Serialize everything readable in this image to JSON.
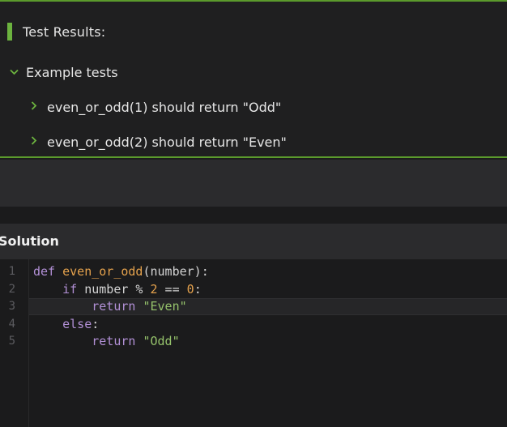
{
  "results": {
    "title": "Test Results:",
    "group": {
      "label": "Example tests",
      "expanded": true
    },
    "tests": [
      {
        "label": "even_or_odd(1) should return \"Odd\"",
        "expanded": false
      },
      {
        "label": "even_or_odd(2) should return \"Even\"",
        "expanded": false
      }
    ]
  },
  "solution": {
    "title": "Solution"
  },
  "editor": {
    "line_numbers": [
      "1",
      "2",
      "3",
      "4",
      "5"
    ],
    "code": {
      "l1_kw": "def",
      "l1_fn": "even_or_odd",
      "l1_rest": "(number):",
      "l2_indent": "    ",
      "l2_kw": "if",
      "l2_mid": " number % ",
      "l2_num1": "2",
      "l2_eq": " == ",
      "l2_num2": "0",
      "l2_colon": ":",
      "l3_indent": "        ",
      "l3_kw": "return",
      "l3_str": "\"Even\"",
      "l4_indent": "    ",
      "l4_kw": "else",
      "l4_colon": ":",
      "l5_indent": "        ",
      "l5_kw": "return",
      "l5_str": "\"Odd\""
    }
  },
  "colors": {
    "accent_green": "#6cb33f",
    "keyword": "#b290d6",
    "function": "#e5a24d",
    "string": "#95c26b"
  },
  "icons": {
    "expand": "chevron-down-icon",
    "collapse": "chevron-right-icon"
  }
}
